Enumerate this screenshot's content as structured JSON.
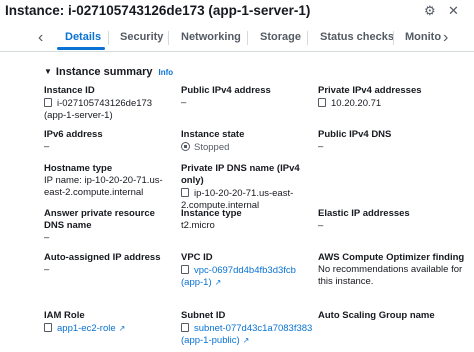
{
  "header": {
    "title": "Instance: i-027105743126de173 (app-1-server-1)"
  },
  "tabs": [
    {
      "label": "Details"
    },
    {
      "label": "Security"
    },
    {
      "label": "Networking"
    },
    {
      "label": "Storage"
    },
    {
      "label": "Status checks"
    },
    {
      "label": "Monito"
    }
  ],
  "summary": {
    "title": "Instance summary",
    "info": "Info"
  },
  "fields": {
    "instance_id": {
      "label": "Instance ID",
      "value": "i-027105743126de173 (app-1-server-1)"
    },
    "public_ipv4": {
      "label": "Public IPv4 address",
      "value": "–"
    },
    "private_ipv4": {
      "label": "Private IPv4 addresses",
      "value": "10.20.20.71"
    },
    "ipv6": {
      "label": "IPv6 address",
      "value": "–"
    },
    "instance_state": {
      "label": "Instance state",
      "value": "Stopped"
    },
    "public_dns": {
      "label": "Public IPv4 DNS",
      "value": "–"
    },
    "hostname_type": {
      "label": "Hostname type",
      "value": "IP name: ip-10-20-20-71.us-east-2.compute.internal"
    },
    "private_dns": {
      "label": "Private IP DNS name (IPv4 only)",
      "value": "ip-10-20-20-71.us-east-2.compute.internal"
    },
    "answer_dns": {
      "label": "Answer private resource DNS name",
      "value": "–"
    },
    "instance_type": {
      "label": "Instance type",
      "value": "t2.micro"
    },
    "elastic_ip": {
      "label": "Elastic IP addresses",
      "value": "–"
    },
    "auto_ip": {
      "label": "Auto-assigned IP address",
      "value": "–"
    },
    "vpc_id": {
      "label": "VPC ID",
      "value": "vpc-0697dd4b4fb3d3fcb (app-1)"
    },
    "optimizer": {
      "label": "AWS Compute Optimizer finding",
      "value": "No recommendations available for this instance."
    },
    "iam_role": {
      "label": "IAM Role",
      "value": "app1-ec2-role"
    },
    "subnet_id": {
      "label": "Subnet ID",
      "value": "subnet-077d43c1a7083f383 (app-1-public)"
    },
    "asg_name": {
      "label": "Auto Scaling Group name",
      "value": ""
    }
  },
  "colors": {
    "link": "#0972d3",
    "text": "#16191f",
    "muted": "#545b64"
  },
  "icons": [
    "gear-icon",
    "close-icon",
    "caret-down-icon",
    "copy-icon",
    "external-link-icon",
    "stopped-icon",
    "chevron-left-icon",
    "chevron-right-icon"
  ]
}
